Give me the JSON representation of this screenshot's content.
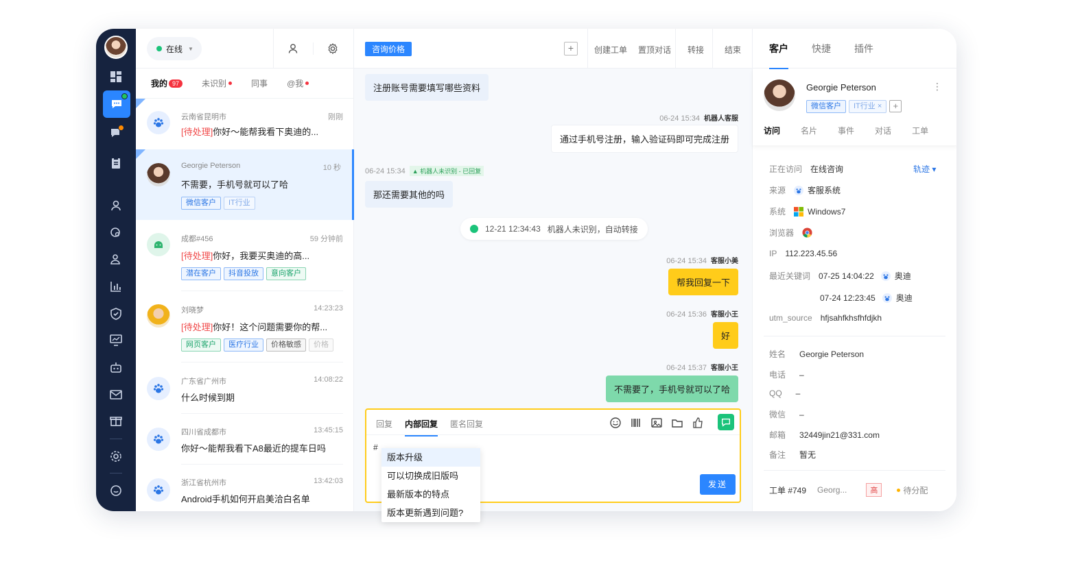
{
  "nav": {
    "items": [
      "dashboard-icon",
      "chat-icon",
      "message-alert-icon",
      "clipboard-icon",
      "user-icon",
      "chat-search-icon",
      "contacts-icon",
      "bar-chart-icon",
      "shield-icon",
      "monitor-chart-icon",
      "robot-icon",
      "mail-icon",
      "gift-icon",
      "settings-icon",
      "feedback-icon"
    ]
  },
  "list": {
    "status": "在线",
    "tabs": [
      {
        "label": "我的",
        "badge": "97"
      },
      {
        "label": "未识别"
      },
      {
        "label": "同事"
      },
      {
        "label": "@我"
      }
    ],
    "conversations": [
      {
        "name": "云南省昆明市",
        "time": "刚刚",
        "pending": "[待处理]",
        "message": "你好～能帮我看下奥迪的...",
        "avatar": "baidu",
        "tags": []
      },
      {
        "name": "Georgie Peterson",
        "time": "10 秒",
        "pending": "",
        "message": "不需要，手机号就可以了哈",
        "avatar": "person",
        "tags": [
          "微信客户",
          "IT行业"
        ]
      },
      {
        "name": "成都#456",
        "time": "59 分钟前",
        "pending": "[待处理]",
        "message": "你好，我要买奥迪的高...",
        "avatar": "android",
        "tags": [
          "潜在客户",
          "抖音投放",
          "意向客户"
        ]
      },
      {
        "name": "刘晓梦",
        "time": "14:23:23",
        "pending": "[待处理]",
        "message": "你好！这个问题需要你的帮...",
        "avatar": "person2",
        "tags": [
          "网页客户",
          "医疗行业",
          "价格敏感",
          "价格"
        ]
      },
      {
        "name": "广东省广州市",
        "time": "14:08:22",
        "pending": "",
        "message": "什么时候到期",
        "avatar": "baidu",
        "tags": []
      },
      {
        "name": "四川省成都市",
        "time": "13:45:15",
        "pending": "",
        "message": "你好～能帮我看下A8最近的提车日吗",
        "avatar": "baidu",
        "tags": []
      },
      {
        "name": "浙江省杭州市",
        "time": "13:42:03",
        "pending": "",
        "message": "Android手机如何开启美洽白名单",
        "avatar": "baidu",
        "tags": []
      }
    ]
  },
  "chat": {
    "topic": "咨询价格",
    "actions": [
      "创建工单",
      "置顶对话",
      "转接",
      "结束"
    ],
    "messages": {
      "m1": "注册账号需要填写哪些资料",
      "m2_meta_time": "06-24 15:34",
      "m2_meta_who": "机器人客服",
      "m2": "通过手机号注册，输入验证码即可完成注册",
      "m3_meta_time": "06-24 15:34",
      "m3_meta_tag": "机器人未识别 - 已回复",
      "m3": "那还需要其他的吗",
      "sys_time": "12-21 12:34:43",
      "sys_text": "机器人未识别，自动转接",
      "m4_meta_time": "06-24 15:34",
      "m4_meta_who": "客服小美",
      "m4": "帮我回复一下",
      "m5_meta_time": "06-24 15:36",
      "m5_meta_who": "客服小王",
      "m5": "好",
      "m6_meta_time": "06-24 15:37",
      "m6_meta_who": "客服小王",
      "m6": "不需要了，手机号就可以了哈"
    },
    "composer": {
      "tabs": [
        "回复",
        "内部回复",
        "匿名回复"
      ],
      "input": "#",
      "send": "发送",
      "suggestions": [
        "版本升级",
        "可以切换成旧版吗",
        "最新版本的特点",
        "版本更新遇到问题?"
      ]
    }
  },
  "panel": {
    "tabs": [
      "客户",
      "快捷",
      "插件"
    ],
    "customer": {
      "name": "Georgie Peterson",
      "tags": [
        "微信客户",
        "IT行业 ×"
      ],
      "subtabs": [
        "访问",
        "名片",
        "事件",
        "对话",
        "工单"
      ]
    },
    "visit": {
      "visiting_label": "正在访问",
      "visiting_value": "在线咨询",
      "track": "轨迹 ▾",
      "source_label": "来源",
      "source_value": "客服系统",
      "system_label": "系统",
      "system_value": "Windows7",
      "browser_label": "浏览器",
      "ip_label": "IP",
      "ip_value": "112.223.45.56",
      "keyword_label": "最近关键词",
      "keywords": [
        {
          "time": "07-25 14:04:22",
          "word": "奥迪"
        },
        {
          "time": "07-24 12:23:45",
          "word": "奥迪"
        }
      ],
      "utm_label": "utm_source",
      "utm_value": "hfjsahfkhsfhfdjkh"
    },
    "profile": {
      "name_label": "姓名",
      "name_value": "Georgie Peterson",
      "phone_label": "电话",
      "phone_value": "–",
      "qq_label": "QQ",
      "qq_value": "–",
      "wechat_label": "微信",
      "wechat_value": "–",
      "email_label": "邮箱",
      "email_value": "32449jin21@331.com",
      "note_label": "备注",
      "note_value": "暂无"
    },
    "ticket": {
      "id": "工单 #749",
      "owner": "Georg...",
      "priority": "高",
      "status": "待分配"
    }
  },
  "colors": {
    "accent": "#2b86ff",
    "rail": "#16233f",
    "highlight": "#ffcc1a",
    "success": "#1bc37a"
  }
}
